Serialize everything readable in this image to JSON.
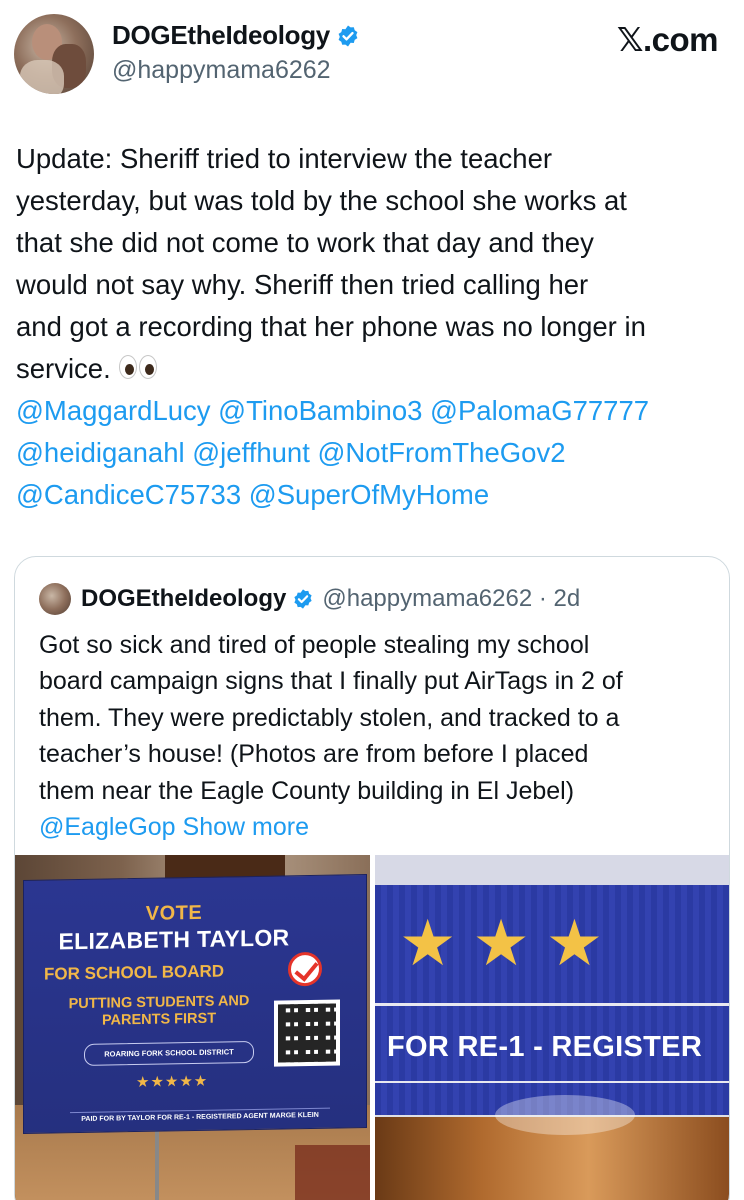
{
  "header": {
    "display_name": "DOGEtheIdeology",
    "handle": "@happymama6262",
    "site_logo": "𝕏.com"
  },
  "tweet": {
    "lines": [
      "Update:  Sheriff tried to interview the teacher",
      "yesterday, but was told by the school she works at",
      "that she did not come to work that day and they",
      "would not say why.  Sheriff then tried calling her",
      "and got a recording that her phone was no longer in",
      "service."
    ],
    "emoji": "eyes-emoji",
    "mention_lines": [
      "@MaggardLucy @TinoBambino3 @PalomaG77777",
      "@heidiganahl  @jeffhunt @NotFromTheGov2",
      "@CandiceC75733 @SuperOfMyHome"
    ]
  },
  "quote": {
    "display_name": "DOGEtheIdeology",
    "handle_time": "@happymama6262 · 2d",
    "lines": [
      "Got so sick and tired of people stealing my school",
      "board campaign signs that I finally put AirTags in 2 of",
      "them.  They were predictably stolen, and tracked to a",
      "teacher’s house!  (Photos are from before I placed",
      "them near the Eagle County building in El Jebel)"
    ],
    "last_line_mention": "@EagleGop",
    "show_more": "Show more"
  },
  "photo1": {
    "vote": "VOTE",
    "name": "ELIZABETH TAYLOR",
    "board": "FOR SCHOOL BOARD",
    "slogan": "PUTTING STUDENTS AND PARENTS FIRST",
    "district": "ROARING FORK SCHOOL DISTRICT",
    "stars": "★★★★★",
    "paid": "PAID FOR BY TAYLOR FOR RE-1 - REGISTERED AGENT MARGE KLEIN"
  },
  "photo2": {
    "text": "FOR RE-1 - REGISTER"
  },
  "colors": {
    "link": "#1d9bf0",
    "text": "#0f1419",
    "muted": "#536471",
    "sign_blue": "#2b3691",
    "sign_gold": "#f1b748"
  }
}
